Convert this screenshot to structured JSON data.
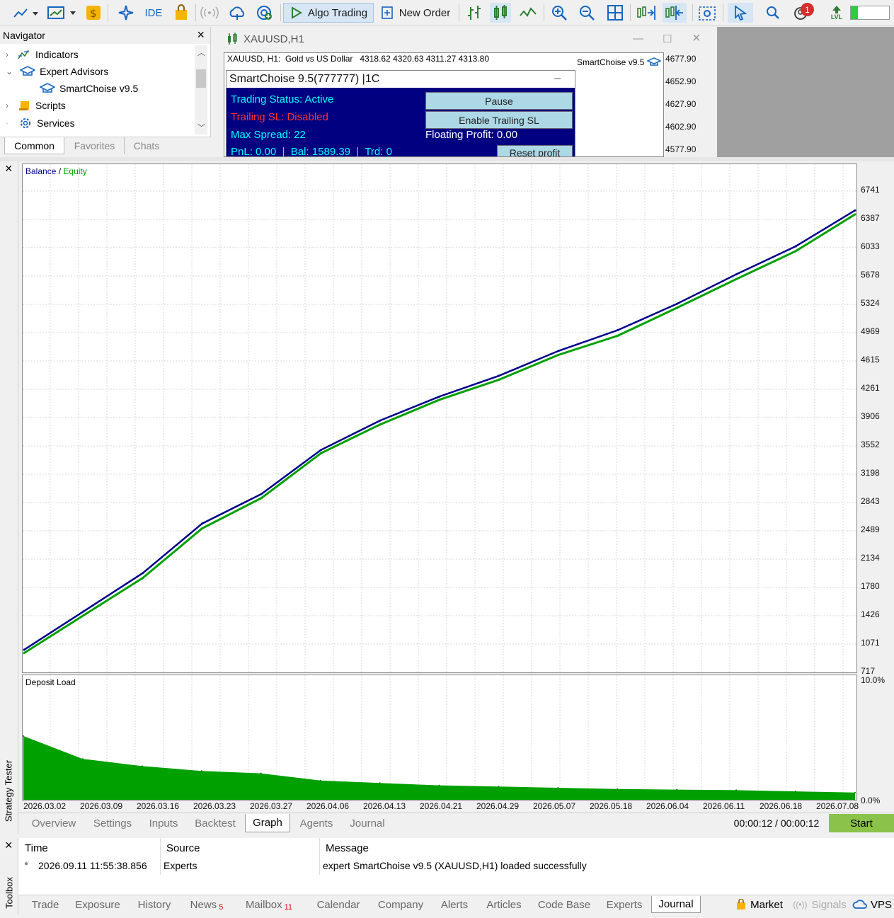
{
  "toolbar": {
    "ide_label": "IDE",
    "algo_trading_label": "Algo Trading",
    "new_order_label": "New Order",
    "notifications_count": "1",
    "lvl_label": "LVL"
  },
  "navigator": {
    "title": "Navigator",
    "items": [
      {
        "label": "Indicators"
      },
      {
        "label": "Expert Advisors"
      },
      {
        "label": "SmartChoise v9.5"
      },
      {
        "label": "Scripts"
      },
      {
        "label": "Services"
      }
    ],
    "tabs": [
      "Common",
      "Favorites",
      "Chats"
    ],
    "active_tab": "Common"
  },
  "chart_window": {
    "title": "XAUUSD,H1",
    "header_text": "XAUUSD, H1:  Gold vs US Dollar   4318.62 4320.63 4311.27 4313.80",
    "ea_label": "SmartChoise v9.5",
    "price_labels": [
      "4677.90",
      "4652.90",
      "4627.90",
      "4602.90",
      "4577.90"
    ],
    "ea_panel": {
      "title": "SmartChoise 9.5(777777)  |1C",
      "trading_status": "Trading Status: Active",
      "trailing_sl": "Trailing SL: Disabled",
      "max_spread": "Max Spread: 22",
      "pnl_line": "PnL: 0.00  |  Bal: 1589.39  |  Trd: 0",
      "floating_profit": "Floating Profit: 0.00",
      "pause_button": "Pause",
      "enable_trailing_button": "Enable Trailing SL",
      "reset_profit_button": "Reset profit",
      "colors": {
        "bg": "#000080",
        "status": "#00ffff",
        "disabled": "#ff3333",
        "white": "#ffffff"
      }
    }
  },
  "tester": {
    "side_label": "Strategy Tester",
    "legend_balance": "Balance",
    "legend_sep": "/",
    "legend_equity": "Equity",
    "deposit_load_label": "Deposit Load",
    "tabs": [
      "Overview",
      "Settings",
      "Inputs",
      "Backtest",
      "Graph",
      "Agents",
      "Journal"
    ],
    "active_tab": "Graph",
    "elapsed": "00:00:12 / 00:00:12",
    "start_button": "Start",
    "colors": {
      "balance": "#00008b",
      "equity": "#00a000",
      "start": "#8bc34a"
    }
  },
  "chart_data": [
    {
      "type": "line",
      "title": "Balance / Equity",
      "x": [
        "2026.03.02",
        "2026.03.09",
        "2026.03.16",
        "2026.03.23",
        "2026.03.27",
        "2026.04.06",
        "2026.04.13",
        "2026.04.21",
        "2026.04.29",
        "2026.05.07",
        "2026.05.18",
        "2026.06.04",
        "2026.06.11",
        "2026.06.18",
        "2026.07.08"
      ],
      "y_ticks": [
        "6741",
        "6387",
        "6033",
        "5678",
        "5324",
        "4969",
        "4615",
        "4261",
        "3906",
        "3552",
        "3198",
        "2843",
        "2489",
        "2134",
        "1780",
        "1426",
        "1071",
        "717"
      ],
      "ylim": [
        717,
        7000
      ],
      "series": [
        {
          "name": "Balance",
          "values": [
            1000,
            1480,
            1960,
            2580,
            2950,
            3500,
            3870,
            4170,
            4430,
            4740,
            5000,
            5330,
            5700,
            6050,
            6500
          ]
        },
        {
          "name": "Equity",
          "values": [
            960,
            1430,
            1900,
            2520,
            2900,
            3460,
            3820,
            4130,
            4380,
            4690,
            4930,
            5280,
            5640,
            5990,
            6450
          ]
        }
      ],
      "grid": true,
      "legend": "top-left"
    },
    {
      "type": "area",
      "title": "Deposit Load",
      "x": [
        "2026.03.02",
        "2026.03.09",
        "2026.03.16",
        "2026.03.23",
        "2026.03.27",
        "2026.04.06",
        "2026.04.13",
        "2026.04.21",
        "2026.04.29",
        "2026.05.07",
        "2026.05.18",
        "2026.06.04",
        "2026.06.11",
        "2026.06.18",
        "2026.07.08"
      ],
      "y_ticks": [
        "10.0%",
        "0.0%"
      ],
      "ylim": [
        0,
        10
      ],
      "values": [
        5.3,
        3.4,
        2.8,
        2.4,
        2.2,
        1.6,
        1.4,
        1.2,
        1.1,
        1.0,
        0.9,
        0.85,
        0.8,
        0.7,
        0.6
      ],
      "grid": true
    }
  ],
  "toolbox": {
    "side_label": "Toolbox",
    "columns": [
      "Time",
      "Source",
      "Message"
    ],
    "rows": [
      {
        "time": "2026.09.11 11:55:38.856",
        "source": "Experts",
        "message": "expert SmartChoise v9.5 (XAUUSD,H1) loaded successfully"
      }
    ],
    "tabs": [
      {
        "label": "Trade"
      },
      {
        "label": "Exposure"
      },
      {
        "label": "History"
      },
      {
        "label": "News",
        "badge": "5"
      },
      {
        "label": "Mailbox",
        "badge": "11"
      },
      {
        "label": "Calendar"
      },
      {
        "label": "Company"
      },
      {
        "label": "Alerts"
      },
      {
        "label": "Articles"
      },
      {
        "label": "Code Base"
      },
      {
        "label": "Experts"
      },
      {
        "label": "Journal"
      }
    ],
    "active_tab": "Journal",
    "market_label": "Market",
    "signals_label": "Signals",
    "vps_label": "VPS"
  }
}
